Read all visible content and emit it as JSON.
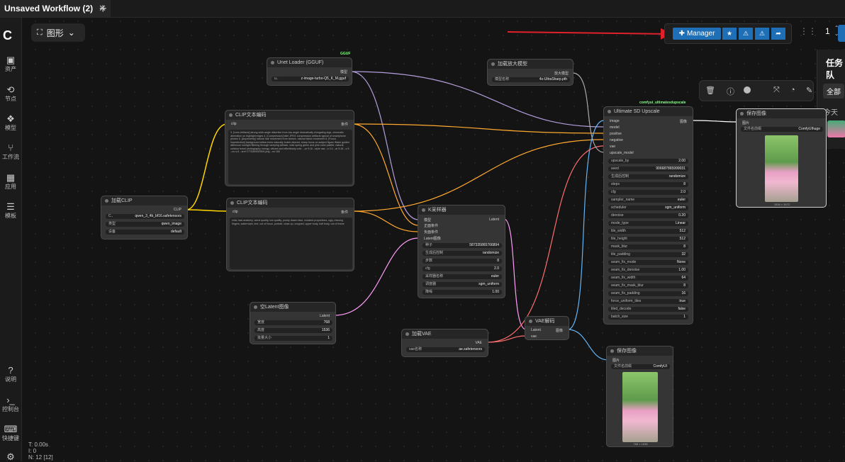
{
  "tab": {
    "title": "Unsaved Workflow (2)",
    "close": "✕",
    "new": "+"
  },
  "mode": {
    "label": "图形",
    "chevron": "⌄"
  },
  "sidebar": [
    {
      "label": "资产",
      "icon": "assets-icon"
    },
    {
      "label": "节点",
      "icon": "nodes-icon"
    },
    {
      "label": "模型",
      "icon": "models-icon"
    },
    {
      "label": "工作流",
      "icon": "workflow-icon"
    },
    {
      "label": "应用",
      "icon": "apps-icon"
    },
    {
      "label": "模板",
      "icon": "templates-icon"
    },
    {
      "label": "说明",
      "icon": "help-icon"
    },
    {
      "label": "控制台",
      "icon": "console-icon"
    },
    {
      "label": "快捷键",
      "icon": "keyboard-icon"
    }
  ],
  "stats": {
    "t": "T: 0.00s",
    "i": "I: 0",
    "n": "N: 12 [12]"
  },
  "manager": {
    "label": "Manager",
    "accent": "#1f6fb7"
  },
  "queue": {
    "count": "1"
  },
  "taskpanel": {
    "title": "任务队",
    "tab_all": "全部",
    "today": "今天"
  },
  "nodes": {
    "unet": {
      "title": "Unet Loader (GGUF)",
      "badge": "GGUF",
      "out": "模型",
      "w_label": "u..",
      "w_value": "z-image-turbo-Q5_K_M.gguf"
    },
    "upscale_loader": {
      "title": "加载放大模型",
      "out": "放大模型",
      "w_label": "模型名称",
      "w_value": "4x-UltraSharp.pth"
    },
    "clip_loader": {
      "title": "加载CLIP",
      "out": "CLIP",
      "w": [
        {
          "l": "C..",
          "v": "qwen_3_4b_bf16.safetensors"
        },
        {
          "l": "类型",
          "v": "qwen_image"
        },
        {
          "l": "设备",
          "v": "default"
        }
      ]
    },
    "clip_pos": {
      "title": "CLIP文本编码",
      "in": "clip",
      "out": "条件",
      "text": "3. [Lens Artifacts] strong wide-angle distortion from low angle dramatically elongating legs, chromatic aberration on highlight edges 4. [Compression] faint JPEG compression artifacts typical of smartphone photos 5. [Asymmetry] natural hair movement from breeze, natural fabric movement 6. [Focus Imperfection] background willow trees naturally bokeh-blurred, sharp focus on subject figure  Warm golden afternoon sunlight filtering through weeping willows, vivid spring green and pink color palette, natural outdoor travel photography energy, vibrant and effortlessly cute. --ar 9:16 --style raw --s 0.4 --ar 9:16 --v 6 --no s.8 --sref 1773083920500.png --no 180"
    },
    "clip_neg": {
      "title": "CLIP文本编码",
      "in": "clip",
      "out": "条件",
      "text": "nsfw, bad anatomy, worst quality, low quality, poorly drawn face, mutated proportions, ugly, missing fingers, watermark, text, out of focus, portrait, close up, cropped, upper body, half body, out of frame"
    },
    "ksampler": {
      "title": "K采样器",
      "in": [
        "模型",
        "正面条件",
        "负面条件",
        "Latent图像"
      ],
      "out": "Latent",
      "w": [
        {
          "l": "种子",
          "v": "587335865766894"
        },
        {
          "l": "生成后控制",
          "v": "randomize"
        },
        {
          "l": "步数",
          "v": "8"
        },
        {
          "l": "cfg",
          "v": "2.0"
        },
        {
          "l": "采样器名称",
          "v": "euler"
        },
        {
          "l": "调度器",
          "v": "sgm_uniform"
        },
        {
          "l": "降噪",
          "v": "1.00"
        }
      ]
    },
    "empty_latent": {
      "title": "空Latent图像",
      "out": "Latent",
      "w": [
        {
          "l": "宽度",
          "v": "768"
        },
        {
          "l": "高度",
          "v": "1536"
        },
        {
          "l": "批量大小",
          "v": "1"
        }
      ]
    },
    "vae_loader": {
      "title": "加载VAE",
      "out": "VAE",
      "w_label": "vae名称",
      "w_value": "ae.safetensors"
    },
    "vae_decode": {
      "title": "VAE解码",
      "in": [
        "Latent",
        "vae"
      ],
      "out": "图像"
    },
    "usdu": {
      "title": "Ultimate SD Upscale",
      "badge": "comfyui_ultimatesdupscale",
      "in": [
        "image",
        "model",
        "positive",
        "negative",
        "vae",
        "upscale_model"
      ],
      "out": "图像",
      "w": [
        {
          "l": "upscale_by",
          "v": "2.00"
        },
        {
          "l": "seed",
          "v": "906687865999031"
        },
        {
          "l": "生成后控制",
          "v": "randomize"
        },
        {
          "l": "steps",
          "v": "8"
        },
        {
          "l": "cfg",
          "v": "2.0"
        },
        {
          "l": "sampler_name",
          "v": "euler"
        },
        {
          "l": "scheduler",
          "v": "sgm_uniform"
        },
        {
          "l": "denoise",
          "v": "0.20"
        },
        {
          "l": "mode_type",
          "v": "Linear"
        },
        {
          "l": "tile_width",
          "v": "512"
        },
        {
          "l": "tile_height",
          "v": "512"
        },
        {
          "l": "mask_blur",
          "v": "8"
        },
        {
          "l": "tile_padding",
          "v": "32"
        },
        {
          "l": "seam_fix_mode",
          "v": "None"
        },
        {
          "l": "seam_fix_denoise",
          "v": "1.00"
        },
        {
          "l": "seam_fix_width",
          "v": "64"
        },
        {
          "l": "seam_fix_mask_blur",
          "v": "8"
        },
        {
          "l": "seam_fix_padding",
          "v": "16"
        },
        {
          "l": "force_uniform_tiles",
          "v": "true"
        },
        {
          "l": "tiled_decode",
          "v": "false"
        },
        {
          "l": "batch_size",
          "v": "1"
        }
      ]
    },
    "save1": {
      "title": "保存图像",
      "in": "图片",
      "w_label": "文件名前缀",
      "w_value": "ComfyUIhuge",
      "caption": "1536 × 3072"
    },
    "save2": {
      "title": "保存图像",
      "in": "图片",
      "w_label": "文件名前缀",
      "w_value": "ComfyUI",
      "caption": "768 × 1536"
    }
  },
  "colors": {
    "model": "#b39ddb",
    "clip": "#ffd500",
    "cond": "#ffa931",
    "latent": "#ff9cf9",
    "vae": "#ff6e6e",
    "image": "#64b5f6",
    "upscale": "#aaaaaa"
  }
}
